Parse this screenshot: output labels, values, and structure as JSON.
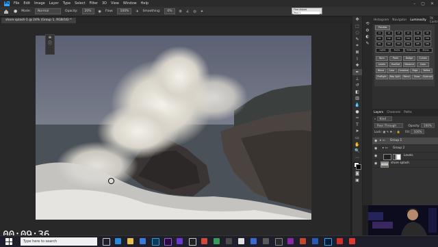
{
  "menubar": {
    "app_icon": "Ps",
    "items": [
      "File",
      "Edit",
      "Image",
      "Layer",
      "Type",
      "Select",
      "Filter",
      "3D",
      "View",
      "Window",
      "Help"
    ],
    "window_controls": [
      "–",
      "▢",
      "✕"
    ]
  },
  "options": {
    "mode_label": "Mode:",
    "mode_value": "Normal",
    "opacity_label": "Opacity:",
    "opacity_value": "20%",
    "flow_label": "Flow:",
    "flow_value": "100%",
    "smoothing_label": "Smoothing:",
    "smoothing_value": "0%"
  },
  "floating_popup": {
    "line1": "Fine Adjust",
    "line2": "Text 1"
  },
  "document": {
    "tab_title": "shore splash-1 @ 24% (Group 1, RGB/16) *"
  },
  "panel_tabs": {
    "tab1": "Histogram",
    "tab2": "Navigator",
    "tab3": "Luminosity",
    "tab4": "TK Control"
  },
  "luminosity": {
    "preview_label": "Preview",
    "buttons": [
      "L1",
      "L2",
      "L3",
      "L4",
      "L5",
      "L6",
      "D1",
      "D2",
      "D3",
      "D4",
      "D5",
      "D6",
      "M1",
      "M2",
      "M3",
      "M4",
      "M5",
      "M6"
    ],
    "row_labels": [
      "Lights",
      "Darks",
      "Midtones",
      "Zones"
    ],
    "tool_row1": [
      "Burn",
      "Paint",
      "Dodge",
      "Curves"
    ],
    "tool_row2": [
      "Levels",
      "Hue/Sat",
      "Vibrance",
      "Color"
    ],
    "tool_row3": [
      "Blend",
      "Color",
      "Combine",
      "Edge",
      "Refine"
    ],
    "tool_row4": [
      "Preflight",
      "Map Split",
      "Blend",
      "Show",
      "Subtract"
    ]
  },
  "layers_panel": {
    "tabs": [
      "Layers",
      "Channels",
      "Paths"
    ],
    "kind_label": "Kind",
    "blend_mode": "Pass Through",
    "opacity_label": "Opacity:",
    "opacity_value": "100%",
    "lock_label": "Lock:",
    "fill_label": "Fill:",
    "fill_value": "100%",
    "layers": [
      {
        "name": "Group 1",
        "selected": true
      },
      {
        "name": "Group 2",
        "selected": false
      },
      {
        "name": "Levels",
        "selected": false
      },
      {
        "name": "shore splash",
        "selected": false
      }
    ]
  },
  "timer": "00:09:36",
  "taskbar": {
    "search_placeholder": "Type here to search"
  }
}
